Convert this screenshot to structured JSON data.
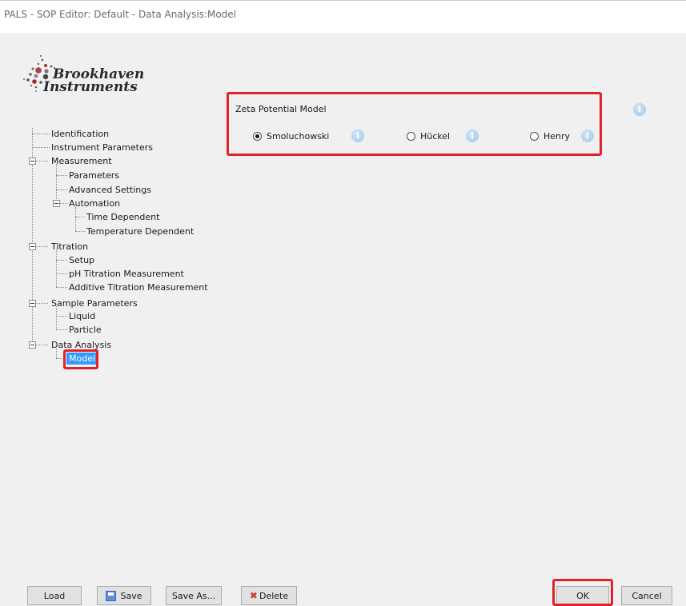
{
  "window": {
    "title": "PALS - SOP Editor: Default - Data Analysis:Model"
  },
  "logo": {
    "line1": "Brookhaven",
    "line2": "Instruments"
  },
  "tree": {
    "identification": "Identification",
    "instrument_parameters": "Instrument Parameters",
    "measurement": "Measurement",
    "parameters": "Parameters",
    "advanced_settings": "Advanced Settings",
    "automation": "Automation",
    "time_dependent": "Time Dependent",
    "temperature_dependent": "Temperature Dependent",
    "titration": "Titration",
    "setup": "Setup",
    "ph_titration": "pH Titration Measurement",
    "additive_titration": "Additive Titration Measurement",
    "sample_parameters": "Sample Parameters",
    "liquid": "Liquid",
    "particle": "Particle",
    "data_analysis": "Data Analysis",
    "model": "Model"
  },
  "model_panel": {
    "group_label": "Zeta Potential Model",
    "options": [
      {
        "label": "Smoluchowski",
        "selected": true
      },
      {
        "label": "Hückel",
        "selected": false
      },
      {
        "label": "Henry",
        "selected": false
      }
    ],
    "info_glyph": "i"
  },
  "buttons": {
    "load": "Load",
    "save": "Save",
    "save_as": "Save As...",
    "delete": "Delete",
    "ok": "OK",
    "cancel": "Cancel"
  },
  "icons": {
    "info": "info-icon",
    "save": "floppy-disk-icon",
    "delete": "red-x-icon"
  },
  "colors": {
    "highlight_red": "#e0222b",
    "selection_blue": "#3399ff",
    "info_blue": "#9cc6ea"
  }
}
